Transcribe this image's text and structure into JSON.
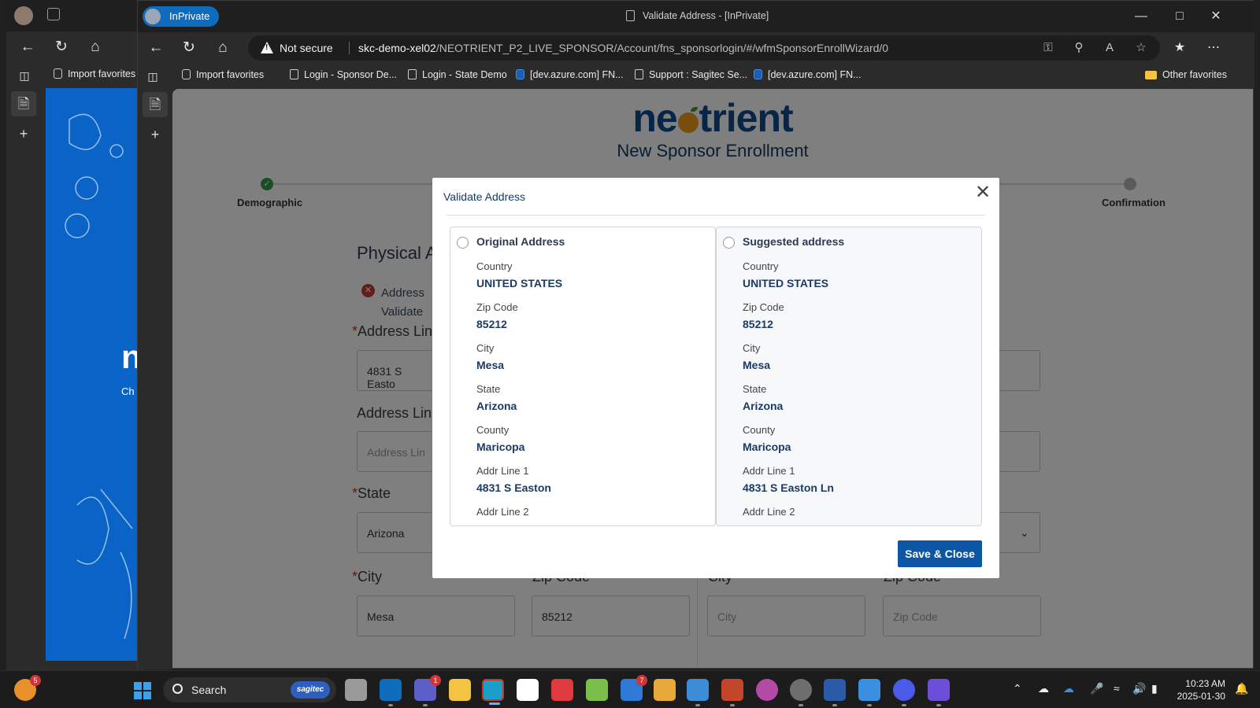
{
  "browser": {
    "inprivate_label": "InPrivate",
    "window_title": "Validate Address - [InPrivate]",
    "not_secure_label": "Not secure",
    "url_host": "skc-demo-xel02",
    "url_path": "/NEOTRIENT_P2_LIVE_SPONSOR/Account/fns_sponsorlogin/#/wfmSponsorEnrollWizard/0",
    "favorites": [
      "Import favorites",
      "Login - Sponsor De...",
      "Login - State Demo",
      "[dev.azure.com] FN...",
      "Support : Sagitec Se...",
      "[dev.azure.com] FN...",
      "Other favorites"
    ]
  },
  "bg_window": {
    "favorite": "Import favorites",
    "big_text": "n",
    "small_text": "Ch"
  },
  "page": {
    "logo_pre": "ne",
    "logo_post": "trient",
    "subtitle": "New Sponsor Enrollment",
    "steps": [
      "Demographic",
      "Confirmation"
    ],
    "section_title": "Physical A",
    "error_line1": "Address",
    "error_line2": "Validate",
    "labels": {
      "address_line1": "Address Lin",
      "address_line2": "Address Lin",
      "state": "State",
      "city": "City",
      "zip": "Zip Code",
      "city_right": "City",
      "zip_right": "Zip Code"
    },
    "values": {
      "address_line1": "4831 S Easto",
      "address_line2_placeholder": "Address Lin",
      "state": "Arizona",
      "city": "Mesa",
      "zip": "85212",
      "city_right_placeholder": "City",
      "zip_right_placeholder": "Zip Code"
    }
  },
  "modal": {
    "title": "Validate Address",
    "save_label": "Save & Close",
    "original": {
      "heading": "Original Address",
      "fields": [
        {
          "label": "Country",
          "value": "UNITED STATES"
        },
        {
          "label": "Zip Code",
          "value": "85212"
        },
        {
          "label": "City",
          "value": "Mesa"
        },
        {
          "label": "State",
          "value": "Arizona"
        },
        {
          "label": "County",
          "value": "Maricopa"
        },
        {
          "label": "Addr Line 1",
          "value": "4831 S Easton"
        },
        {
          "label": "Addr Line 2",
          "value": ""
        }
      ]
    },
    "suggested": {
      "heading": "Suggested address",
      "fields": [
        {
          "label": "Country",
          "value": "UNITED STATES"
        },
        {
          "label": "Zip Code",
          "value": "85212"
        },
        {
          "label": "City",
          "value": "Mesa"
        },
        {
          "label": "State",
          "value": "Arizona"
        },
        {
          "label": "County",
          "value": "Maricopa"
        },
        {
          "label": "Addr Line 1",
          "value": "4831 S Easton Ln"
        },
        {
          "label": "Addr Line 2",
          "value": ""
        }
      ]
    }
  },
  "taskbar": {
    "search_label": "Search",
    "search_badge": "sagitec",
    "weather_badge": "5",
    "teams_badge": "1",
    "todo_badge": "7",
    "time": "10:23 AM",
    "date": "2025-01-30"
  },
  "colors": {
    "brand": "#0f4d8f",
    "accent_button": "#0d56a6",
    "inprivate": "#0f6cbd",
    "success": "#2f9e44",
    "error": "#c93a3a"
  }
}
